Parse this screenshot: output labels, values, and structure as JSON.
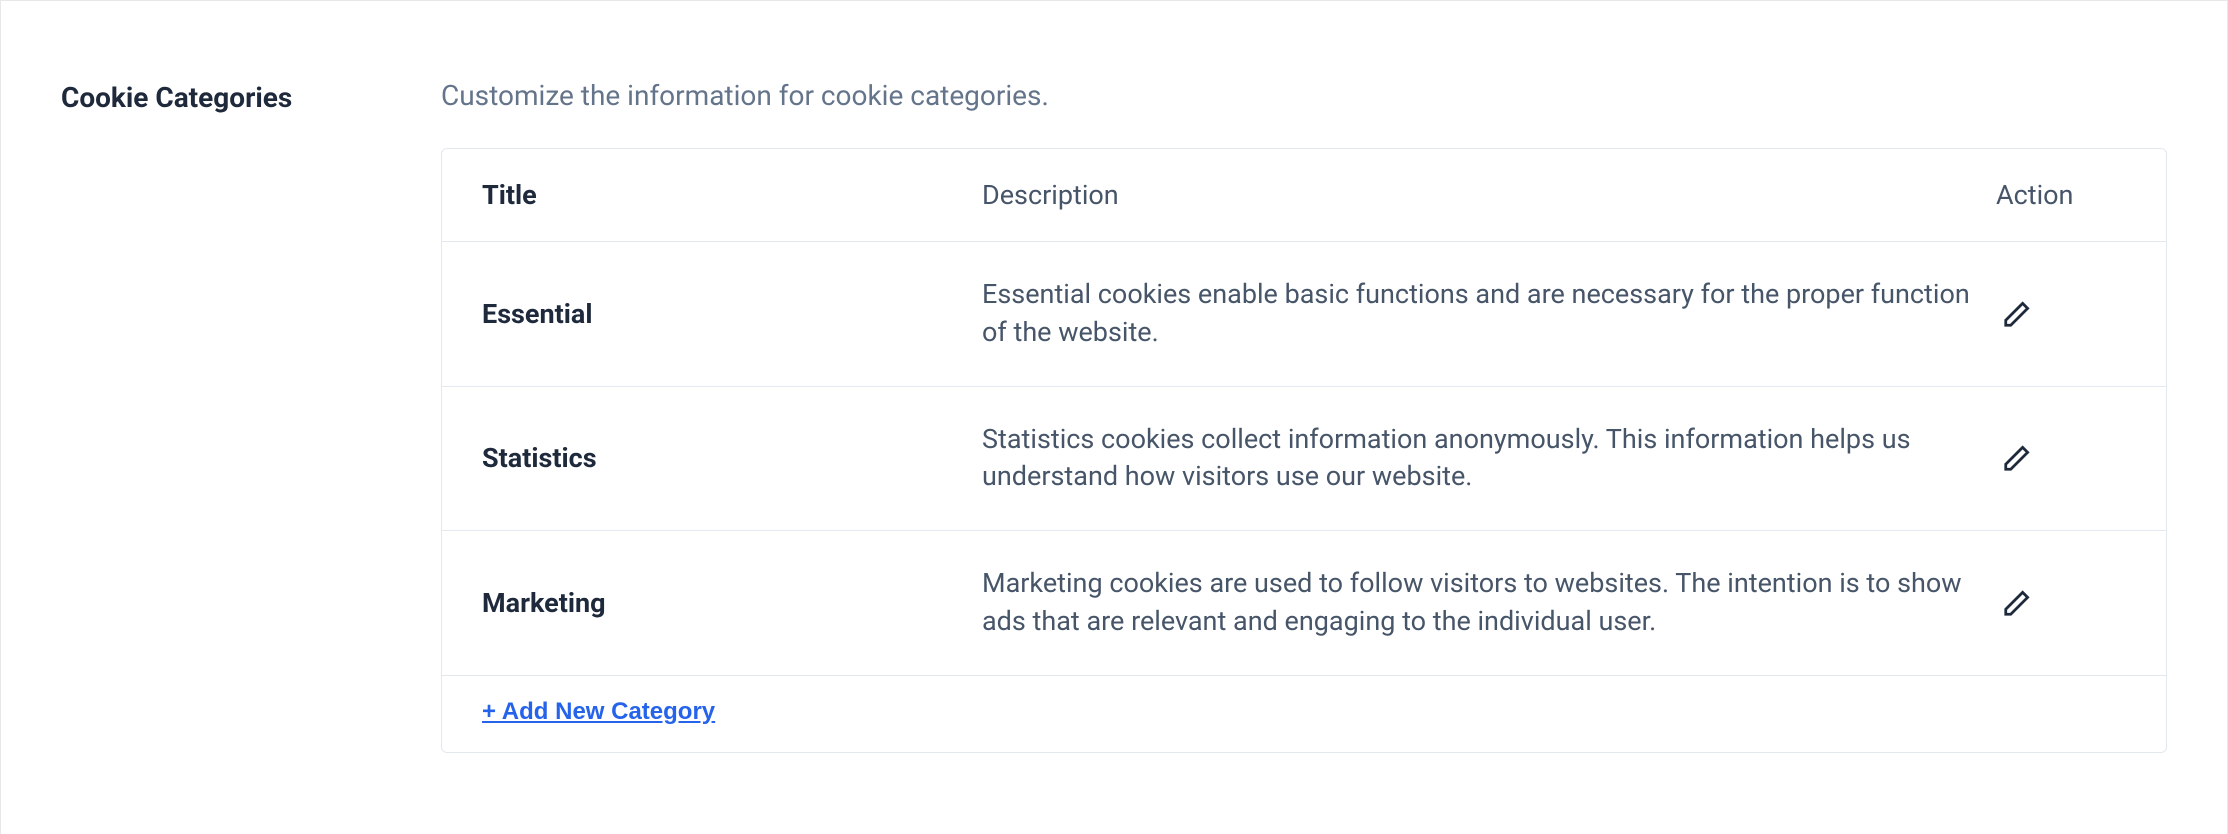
{
  "section": {
    "label": "Cookie Categories",
    "subtitle": "Customize the information for cookie categories."
  },
  "table": {
    "headers": {
      "title": "Title",
      "description": "Description",
      "action": "Action"
    },
    "rows": [
      {
        "title": "Essential",
        "description": "Essential cookies enable basic functions and are necessary for the proper function of the website."
      },
      {
        "title": "Statistics",
        "description": "Statistics cookies collect information anonymously. This information helps us understand how visitors use our website."
      },
      {
        "title": "Marketing",
        "description": "Marketing cookies are used to follow visitors to websites. The intention is to show ads that are relevant and engaging to the individual user."
      }
    ]
  },
  "footer": {
    "add_link": "+ Add New Category"
  }
}
